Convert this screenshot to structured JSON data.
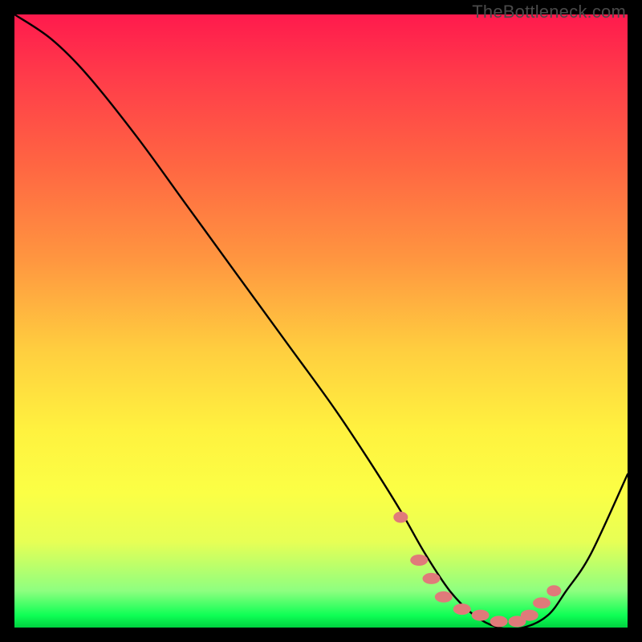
{
  "watermark": "TheBottleneck.com",
  "chart_data": {
    "type": "line",
    "title": "",
    "xlabel": "",
    "ylabel": "",
    "xlim": [
      0,
      100
    ],
    "ylim": [
      0,
      100
    ],
    "series": [
      {
        "name": "bottleneck-curve",
        "x": [
          0,
          6,
          12,
          20,
          28,
          36,
          44,
          52,
          58,
          63,
          67,
          71,
          75,
          79,
          83,
          87,
          90,
          94,
          100
        ],
        "y": [
          100,
          96,
          90,
          80,
          69,
          58,
          47,
          36,
          27,
          19,
          12,
          6,
          2,
          0,
          0,
          2,
          6,
          12,
          25
        ]
      }
    ],
    "markers": {
      "name": "optimal-dots",
      "color": "#e07a7a",
      "points": [
        {
          "x": 63,
          "y": 18
        },
        {
          "x": 66,
          "y": 11
        },
        {
          "x": 68,
          "y": 8
        },
        {
          "x": 70,
          "y": 5
        },
        {
          "x": 73,
          "y": 3
        },
        {
          "x": 76,
          "y": 2
        },
        {
          "x": 79,
          "y": 1
        },
        {
          "x": 82,
          "y": 1
        },
        {
          "x": 84,
          "y": 2
        },
        {
          "x": 86,
          "y": 4
        },
        {
          "x": 88,
          "y": 6
        }
      ]
    },
    "background": {
      "type": "vertical-gradient",
      "stops": [
        {
          "pos": 0.0,
          "color": "#ff1a4d"
        },
        {
          "pos": 0.5,
          "color": "#ffcf3f"
        },
        {
          "pos": 0.8,
          "color": "#fbff45"
        },
        {
          "pos": 0.98,
          "color": "#0fff55"
        },
        {
          "pos": 1.0,
          "color": "#00d040"
        }
      ]
    }
  }
}
